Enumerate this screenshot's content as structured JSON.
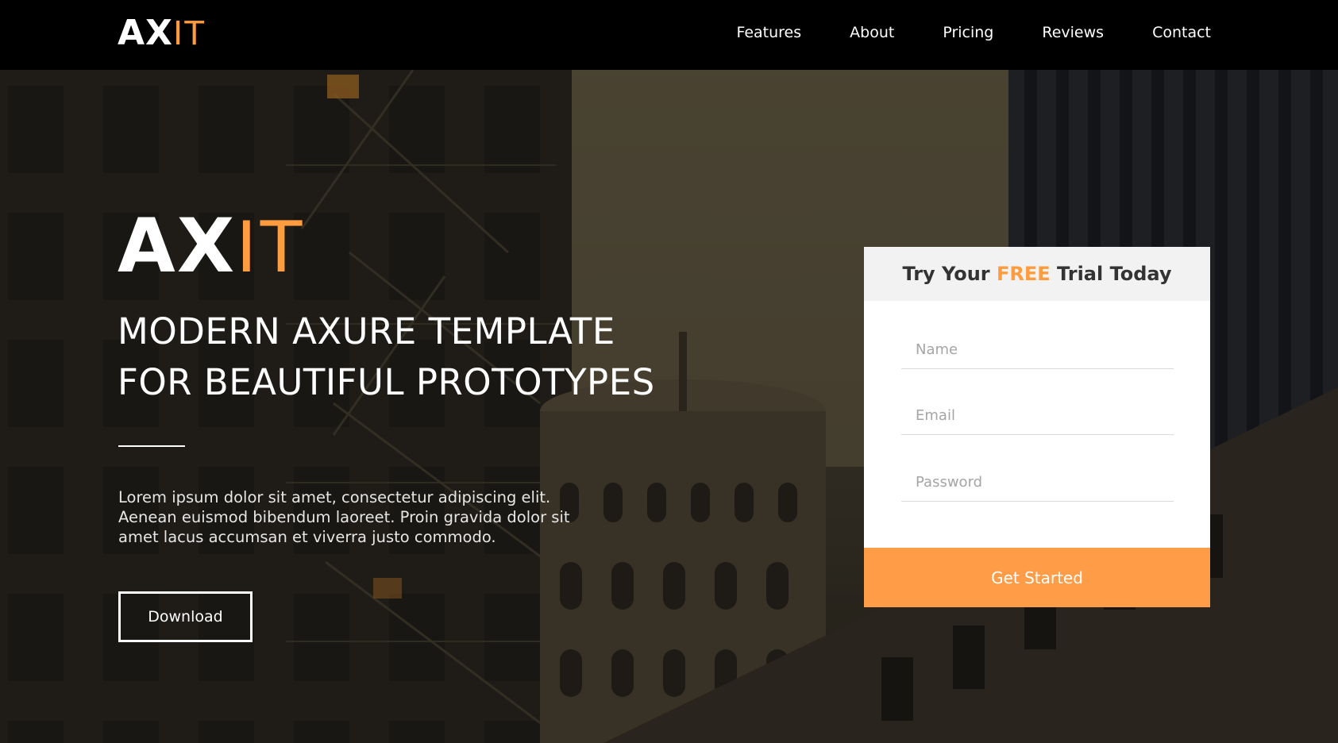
{
  "brand": {
    "prefix": "AX",
    "suffix": "IT"
  },
  "nav": {
    "items": [
      "Features",
      "About",
      "Pricing",
      "Reviews",
      "Contact"
    ]
  },
  "hero": {
    "logo_prefix": "AX",
    "logo_suffix": "IT",
    "headline_line1": "MODERN AXURE TEMPLATE",
    "headline_line2": "FOR BEAUTIFUL PROTOTYPES",
    "intro": "Lorem ipsum dolor sit amet, consectetur adipiscing elit. Aenean euismod bibendum laoreet. Proin gravida dolor sit amet lacus accumsan et viverra justo commodo.",
    "download_label": "Download"
  },
  "signup": {
    "title_before": "Try Your ",
    "title_highlight": "FREE",
    "title_after": " Trial Today",
    "name_placeholder": "Name",
    "email_placeholder": "Email",
    "password_placeholder": "Password",
    "submit_label": "Get Started"
  },
  "colors": {
    "accent": "#ff9c3f",
    "button": "#ff9c47",
    "topbar": "#000000",
    "card_header": "#f2f2f2"
  }
}
